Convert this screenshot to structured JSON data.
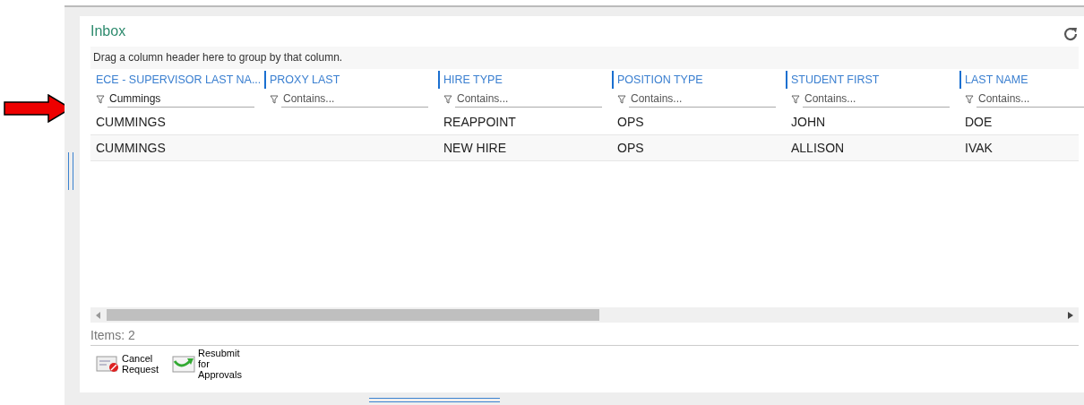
{
  "panel": {
    "title": "Inbox"
  },
  "group_hint": "Drag a column header here to group by that column.",
  "table": {
    "columns": [
      {
        "header": "ECE - SUPERVISOR LAST NA...",
        "filter": {
          "value": "Cummings"
        }
      },
      {
        "header": "PROXY LAST",
        "filter": {
          "placeholder": "Contains..."
        }
      },
      {
        "header": "HIRE TYPE",
        "filter": {
          "placeholder": "Contains..."
        }
      },
      {
        "header": "POSITION TYPE",
        "filter": {
          "placeholder": "Contains..."
        }
      },
      {
        "header": "STUDENT FIRST",
        "filter": {
          "placeholder": "Contains..."
        }
      },
      {
        "header": "LAST NAME",
        "filter": {
          "placeholder": "Contains..."
        }
      }
    ],
    "rows": [
      [
        "CUMMINGS",
        "",
        "REAPPOINT",
        "OPS",
        "JOHN",
        "DOE"
      ],
      [
        "CUMMINGS",
        "",
        "NEW HIRE",
        "OPS",
        "ALLISON",
        "IVAK"
      ]
    ]
  },
  "status": "Items: 2",
  "actions": [
    {
      "kind": "cancel",
      "label": "Cancel Request"
    },
    {
      "kind": "resubmit",
      "label": "Resubmit for Approvals"
    }
  ]
}
